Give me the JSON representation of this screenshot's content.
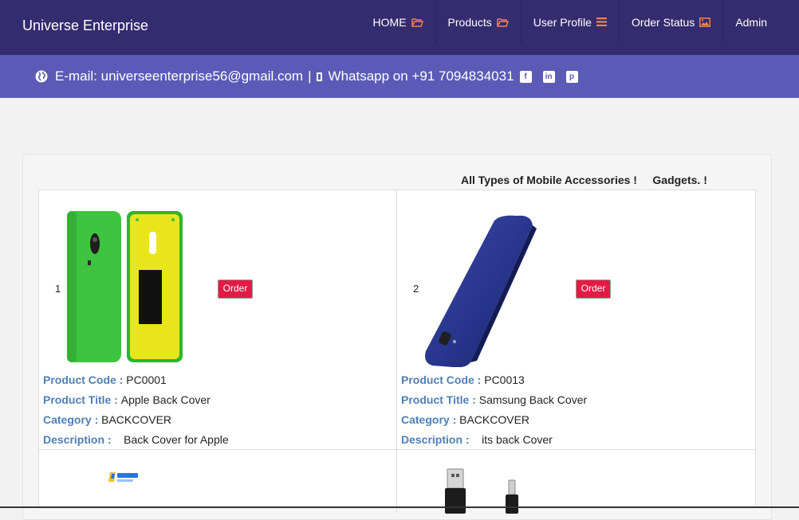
{
  "brand": "Universe Enterprise",
  "nav": [
    {
      "label": "HOME",
      "icon": "folder-open-icon"
    },
    {
      "label": "Products",
      "icon": "folder-open-icon"
    },
    {
      "label": "User Profile",
      "icon": "menu-icon"
    },
    {
      "label": "Order Status",
      "icon": "image-icon"
    },
    {
      "label": "Admin",
      "icon": ""
    }
  ],
  "contact": {
    "email_text": "E-mail: universeenterprise56@gmail.com",
    "separator": "|",
    "whatsapp_text": "Whatsapp on +91 7094834031",
    "social": [
      "facebook-icon",
      "linkedin-icon",
      "pinterest-icon"
    ]
  },
  "tagline": "All Types of Mobile Accessories !     Gadgets. !",
  "labels": {
    "code": "Product Code : ",
    "title": "Product Title : ",
    "category": "Category : ",
    "description": "Description :    "
  },
  "order_label": "Order",
  "products": [
    {
      "index": "1",
      "code": "PC0001",
      "title": "Apple Back Cover",
      "category": "BACKCOVER",
      "description": "Back Cover for Apple",
      "image": "green-yellow-phone-back-cover"
    },
    {
      "index": "2",
      "code": "PC0013",
      "title": "Samsung Back Cover",
      "category": "BACKCOVER",
      "description": "its back Cover",
      "image": "blue-phone-back-cover"
    }
  ],
  "partial_products": [
    {
      "image": "flipkart-logo-image"
    },
    {
      "image": "usb-cable-image"
    }
  ],
  "colors": {
    "topbar": "#352b6f",
    "infobar": "#5b5bb7",
    "accent_icon": "#f0834d",
    "order_button": "#e31b44",
    "field_label": "#4f7fb8"
  }
}
